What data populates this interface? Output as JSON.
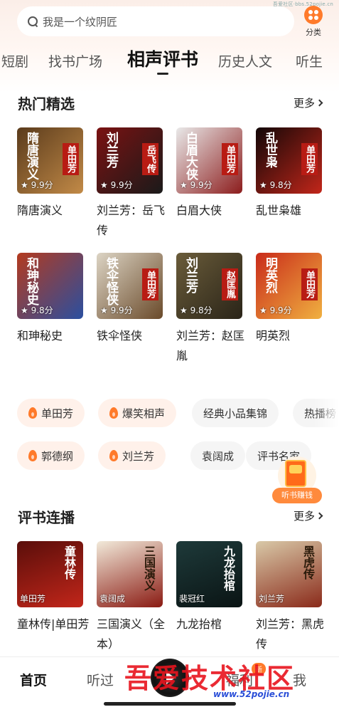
{
  "watermark_top": "吾爱社区·bbs.52pojie.cn",
  "search": {
    "placeholder": "我是一个纹阴匠",
    "category_label": "分类"
  },
  "tabs": [
    "短剧",
    "找书广场",
    "相声评书",
    "历史人文",
    "听生"
  ],
  "active_tab": "相声评书",
  "hot": {
    "title": "热门精选",
    "more": "更多",
    "items": [
      {
        "title": "隋唐演义",
        "rating": "9.9分",
        "cover_text": "隋唐演义",
        "badge": "单田芳",
        "colors": [
          "#5a3b1c",
          "#c28a47"
        ]
      },
      {
        "title": "刘兰芳：岳飞传",
        "rating": "9.9分",
        "cover_text": "刘兰芳",
        "badge": "岳飞传",
        "colors": [
          "#7a1212",
          "#1a1a1a"
        ]
      },
      {
        "title": "白眉大侠",
        "rating": "9.9分",
        "cover_text": "白眉大侠",
        "badge": "单田芳",
        "colors": [
          "#e9e9e9",
          "#8c1c1c"
        ]
      },
      {
        "title": "乱世枭雄",
        "rating": "9.8分",
        "cover_text": "乱世枭",
        "badge": "单田芳",
        "colors": [
          "#120707",
          "#c2261a"
        ]
      },
      {
        "title": "和珅秘史",
        "rating": "9.8分",
        "cover_text": "和珅秘史",
        "badge": "",
        "colors": [
          "#b43a1e",
          "#2a4fa0"
        ]
      },
      {
        "title": "铁伞怪侠",
        "rating": "9.9分",
        "cover_text": "铁伞怪侠",
        "badge": "单田芳",
        "colors": [
          "#dcd4c4",
          "#6a4a2a"
        ]
      },
      {
        "title": "刘兰芳：赵匡胤",
        "rating": "9.8分",
        "cover_text": "刘兰芳",
        "badge": "赵匡胤",
        "colors": [
          "#6a5c3a",
          "#2a2418"
        ]
      },
      {
        "title": "明英烈",
        "rating": "9.9分",
        "cover_text": "明英烈",
        "badge": "单田芳",
        "colors": [
          "#c92b1a",
          "#f0b040"
        ]
      }
    ]
  },
  "chips_row1": [
    {
      "label": "单田芳",
      "hot": true
    },
    {
      "label": "爆笑相声",
      "hot": true
    },
    {
      "label": "经典小品集锦",
      "hot": false
    },
    {
      "label": "热播榜",
      "hot": false
    }
  ],
  "chips_row2": [
    {
      "label": "郭德纲",
      "hot": true
    },
    {
      "label": "刘兰芳",
      "hot": true
    },
    {
      "label": "袁阔成",
      "hot": false
    },
    {
      "label": "评书名家",
      "hot": false
    }
  ],
  "earn_label": "听书赚钱",
  "serial": {
    "title": "评书连播",
    "more": "更多",
    "items": [
      {
        "title": "童林传|单田芳",
        "author": "单田芳",
        "cover_text": "童林传",
        "colors": [
          "#5a0e0a",
          "#c2261a"
        ]
      },
      {
        "title": "三国演义（全本）",
        "author": "袁阔成",
        "cover_text": "三国演义",
        "colors": [
          "#f2eada",
          "#8a1a12"
        ]
      },
      {
        "title": "九龙抬棺",
        "author": "裴冠红",
        "cover_text": "九龙抬棺",
        "colors": [
          "#1e3a3a",
          "#0a1414"
        ]
      },
      {
        "title": "刘兰芳：黑虎传",
        "author": "刘兰芳",
        "cover_text": "黑虎传",
        "colors": [
          "#d9c9a8",
          "#8a2a1a"
        ]
      }
    ]
  },
  "nav": {
    "home": "首页",
    "listened": "听过",
    "welfare": "福利",
    "mine": "我",
    "new_badge": "新"
  },
  "watermark_bottom": {
    "text": "吾爱技术社区",
    "url": "www.52pojie.cn"
  }
}
